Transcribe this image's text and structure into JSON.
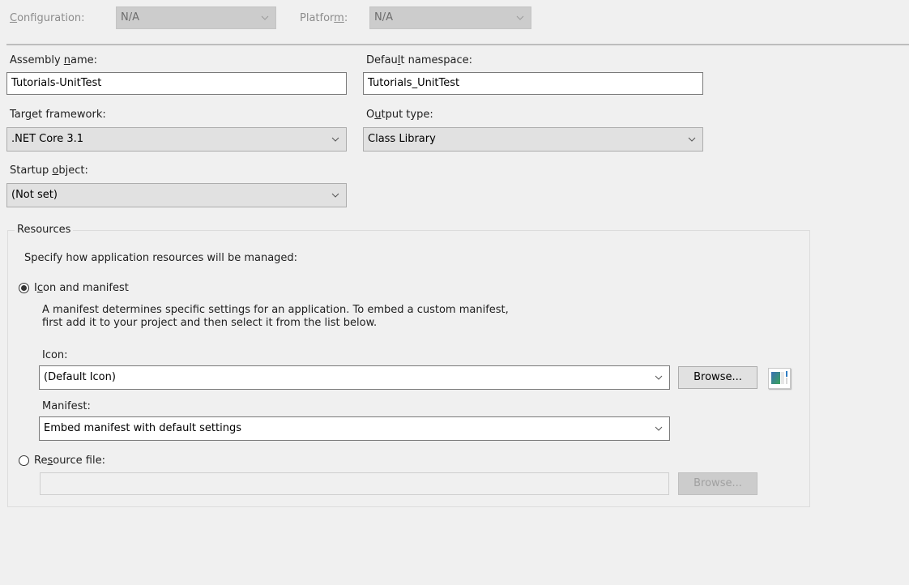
{
  "top_bar": {
    "configuration": {
      "label_pre": "",
      "label_accel": "C",
      "label_post": "onfiguration:",
      "value": "N/A"
    },
    "platform": {
      "label_pre": "Platfor",
      "label_accel": "m",
      "label_post": ":",
      "value": "N/A"
    }
  },
  "application": {
    "assembly_name": {
      "label_pre": "Assembly ",
      "label_accel": "n",
      "label_post": "ame:",
      "value": "Tutorials-UnitTest"
    },
    "default_namespace": {
      "label_pre": "Defau",
      "label_accel": "l",
      "label_post": "t namespace:",
      "value": "Tutorials_UnitTest"
    },
    "target_framework": {
      "label_pre": "Tar",
      "label_accel": "g",
      "label_post": "et framework:",
      "value": ".NET Core 3.1"
    },
    "output_type": {
      "label_pre": "O",
      "label_accel": "u",
      "label_post": "tput type:",
      "value": "Class Library"
    },
    "startup_object": {
      "label_pre": "Startup ",
      "label_accel": "o",
      "label_post": "bject:",
      "value": "(Not set)"
    }
  },
  "resources": {
    "title": "Resources",
    "description": "Specify how application resources will be managed:",
    "icon_and_manifest": {
      "label_pre": "I",
      "label_accel": "c",
      "label_post": "on and manifest",
      "selected": true,
      "help_line1": "A manifest determines specific settings for an application. To embed a custom manifest,",
      "help_line2": "first add it to your project and then select it from the list below.",
      "icon_label": "Icon:",
      "icon_value": "(Default Icon)",
      "browse_label": "Browse...",
      "manifest_label": "Manifest:",
      "manifest_value": "Embed manifest with default settings"
    },
    "resource_file": {
      "label_pre": "Re",
      "label_accel": "s",
      "label_post": "ource file:",
      "selected": false,
      "value": "",
      "browse_label": "Browse..."
    }
  },
  "icons": {
    "dropdown": "chevron-down-icon",
    "icon_preview": "application-icon-preview"
  }
}
